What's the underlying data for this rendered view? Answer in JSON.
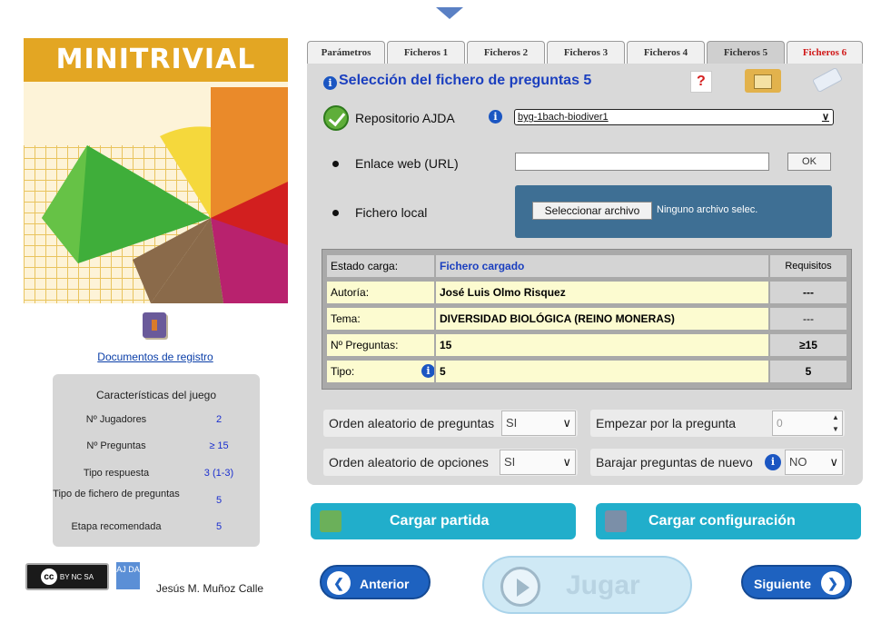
{
  "cover": {
    "title": "MINITRIVIAL"
  },
  "sidebar": {
    "doc_link": "Documentos de registro",
    "features_title": "Características del juego",
    "features": [
      {
        "label": "Nº Jugadores",
        "value": "2"
      },
      {
        "label": "Nº Preguntas",
        "value": "≥ 15"
      },
      {
        "label": "Tipo respuesta",
        "value": "3 (1-3)"
      },
      {
        "label": "Tipo de fichero de preguntas",
        "value": "5"
      },
      {
        "label": "Etapa recomendada",
        "value": "5"
      }
    ],
    "license": {
      "cc": "cc",
      "small": "BY NC SA"
    },
    "ajda_logo": "AJ DA",
    "author": "Jesús M. Muñoz Calle"
  },
  "tabs": [
    {
      "label": "Parámetros"
    },
    {
      "label": "Ficheros 1"
    },
    {
      "label": "Ficheros 2"
    },
    {
      "label": "Ficheros 3"
    },
    {
      "label": "Ficheros 4"
    },
    {
      "label": "Ficheros 5"
    },
    {
      "label": "Ficheros 6"
    }
  ],
  "panel": {
    "title": "Selección del fichero de preguntas 5",
    "info_glyph": "i",
    "help_glyph": "?",
    "repo_label": "Repositorio AJDA",
    "repo_value": "byg-1bach-biodiver1",
    "url_label": "Enlace web (URL)",
    "url_value": "",
    "ok_label": "OK",
    "local_label": "Fichero local",
    "file_button": "Seleccionar archivo",
    "file_none": "Ninguno archivo selec."
  },
  "status_table": {
    "header": {
      "label": "Estado carga:",
      "value": "Fichero cargado",
      "req": "Requisitos"
    },
    "rows": [
      {
        "label": "Autoría:",
        "value": "José Luis Olmo Risquez",
        "req": "---"
      },
      {
        "label": "Tema:",
        "value": "DIVERSIDAD BIOLÓGICA (REINO MONERAS)",
        "req": "---"
      },
      {
        "label": "Nº Preguntas:",
        "value": "15",
        "req": "≥15"
      },
      {
        "label": "Tipo:",
        "value": "5",
        "req": "5"
      }
    ]
  },
  "options": {
    "random_questions": {
      "label": "Orden aleatorio de preguntas",
      "value": "SI"
    },
    "start_question": {
      "label": "Empezar por la pregunta",
      "value": "0"
    },
    "random_options": {
      "label": "Orden aleatorio de opciones",
      "value": "SI"
    },
    "reshuffle": {
      "label": "Barajar preguntas de nuevo",
      "value": "NO"
    }
  },
  "actions": {
    "load_game": "Cargar partida",
    "load_config": "Cargar configuración",
    "prev": "Anterior",
    "play": "Jugar",
    "next": "Siguiente"
  },
  "colors": {
    "accent": "#21aecb",
    "nav": "#1e62c0",
    "title_blue": "#1b3fbf",
    "cover_gold": "#e3a623",
    "fichero6_red": "#d01818"
  }
}
